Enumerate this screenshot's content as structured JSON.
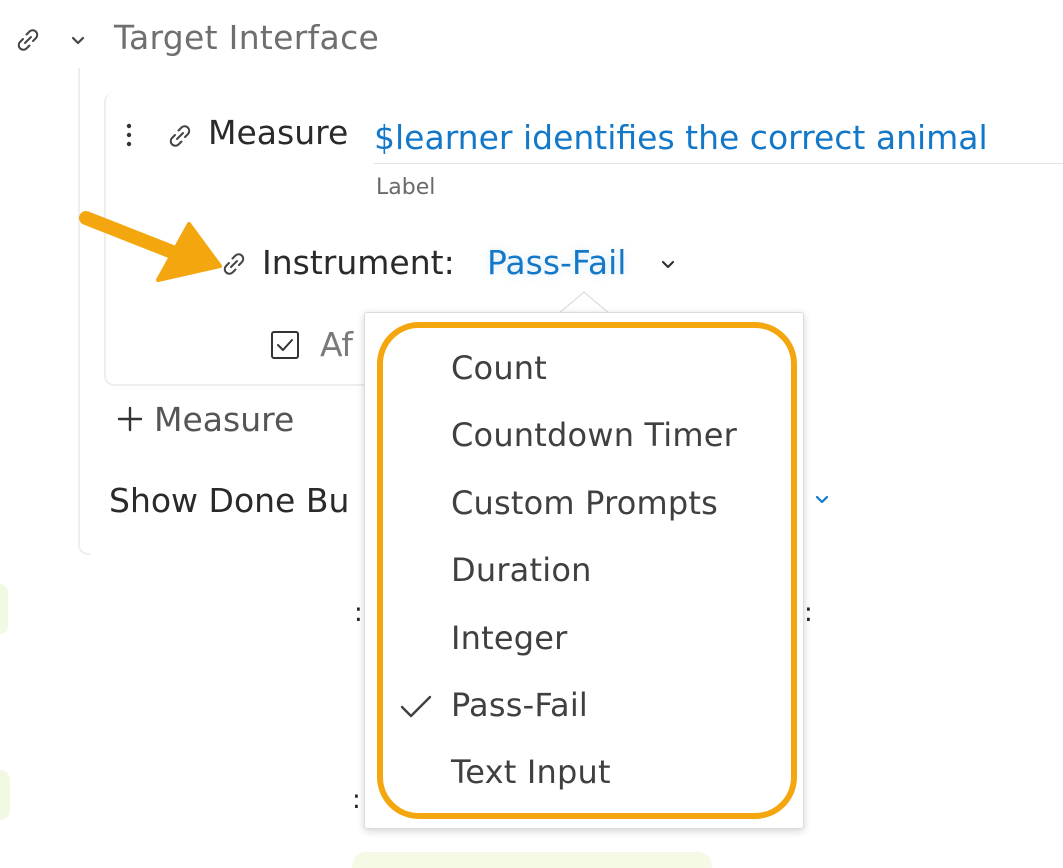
{
  "header": {
    "title": "Target Interface",
    "link_icon": "link-icon",
    "chevron_icon": "chevron-down-icon"
  },
  "measure": {
    "prefix": "Measure",
    "label_value": "$learner identifies the correct animal",
    "label_caption": "Label",
    "menu_icon": "kebab-menu-icon",
    "link_icon": "link-icon"
  },
  "instrument": {
    "label": "Instrument:",
    "value": "Pass-Fail",
    "link_icon": "link-icon",
    "chevron_icon": "chevron-down-icon"
  },
  "after_row": {
    "visible_text": "Af",
    "checked": true
  },
  "add_measure": {
    "label": "Measure",
    "icon": "plus-icon"
  },
  "show_done": {
    "visible_text": "Show Done Bu",
    "chevron_icon": "chevron-down-icon"
  },
  "background_fragments": [
    ":",
    ":",
    ":"
  ],
  "dropdown": {
    "options": [
      {
        "label": "Count",
        "selected": false
      },
      {
        "label": "Countdown Timer",
        "selected": false
      },
      {
        "label": "Custom Prompts",
        "selected": false
      },
      {
        "label": "Duration",
        "selected": false
      },
      {
        "label": "Integer",
        "selected": false
      },
      {
        "label": "Pass-Fail",
        "selected": true
      },
      {
        "label": "Text Input",
        "selected": false
      }
    ],
    "check_icon": "checkmark-icon"
  },
  "colors": {
    "accent_blue": "#1478c8",
    "annotation_orange": "#f4a60e",
    "muted_text": "#6f6f6f"
  }
}
